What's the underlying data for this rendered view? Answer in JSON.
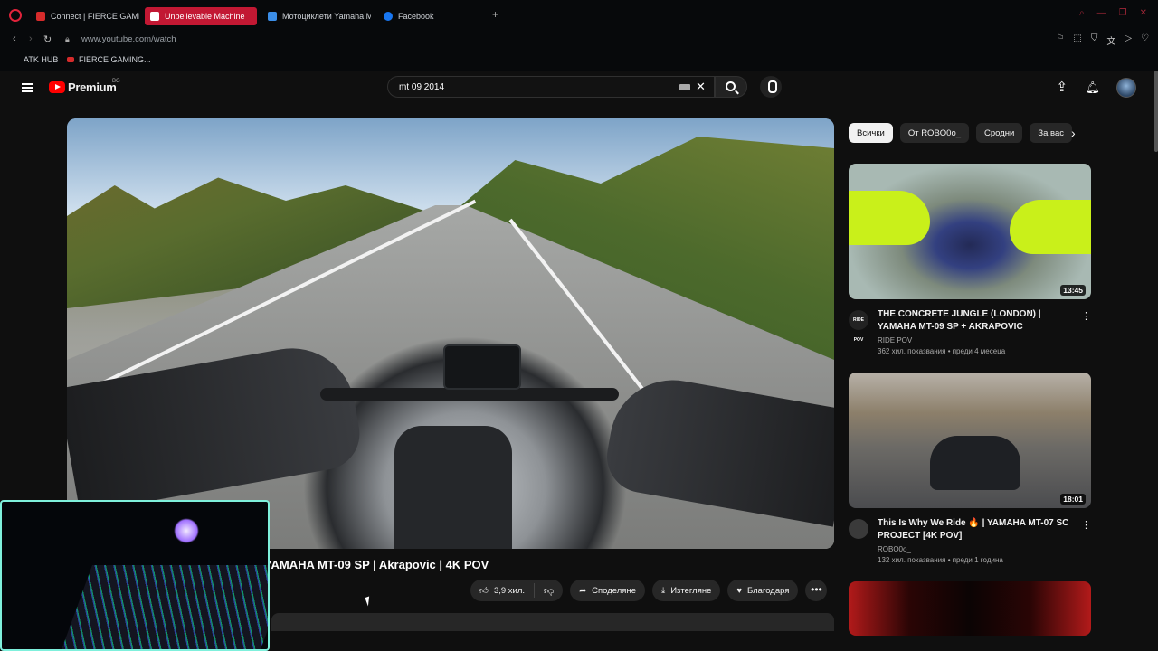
{
  "browser": {
    "tabs": [
      {
        "label": "Connect | FIERCE GAMING",
        "color": "#d62b2b"
      },
      {
        "label": "Unbelievable Machine",
        "color": "#ffffff"
      },
      {
        "label": "Мотоциклети Yamaha M",
        "color": "#3b8ee8"
      },
      {
        "label": "Facebook",
        "color": "#1877f2"
      }
    ],
    "new_tab": "+",
    "url": "www.youtube.com/watch",
    "bookmarks": [
      "ATK HUB",
      "FIERCE GAMING..."
    ]
  },
  "header": {
    "logo_text": "Premium",
    "country": "BG",
    "search_value": "mt 09 2014"
  },
  "video": {
    "title": "YAMAHA MT-09 SP | Akrapovic | 4K POV",
    "likes": "3,9 хил.",
    "share_label": "Споделяне",
    "download_label": "Изтегляне",
    "thanks_label": "Благодаря",
    "more": "•••"
  },
  "sidebar": {
    "chips": [
      "Всички",
      "От ROBO0o_",
      "Сродни",
      "За вас"
    ],
    "recommendations": [
      {
        "title": "THE CONCRETE JUNGLE (LONDON) | YAMAHA MT-09 SP + AKRAPOVIC",
        "channel": "RIDE POV",
        "stats": "362 хил. показвания • преди 4 месеца",
        "duration": "13:45",
        "avatar_text": "RIDE POV"
      },
      {
        "title": "This Is Why We Ride 🔥 | YAMAHA MT-07 SC PROJECT [4K POV]",
        "channel": "ROBO0o_",
        "stats": "132 хил. показвания • преди 1 година",
        "duration": "18:01",
        "avatar_text": ""
      }
    ]
  },
  "colors": {
    "accent": "#ff0000",
    "active_tab": "#c21833",
    "webcam_border": "#7ff0dc"
  }
}
